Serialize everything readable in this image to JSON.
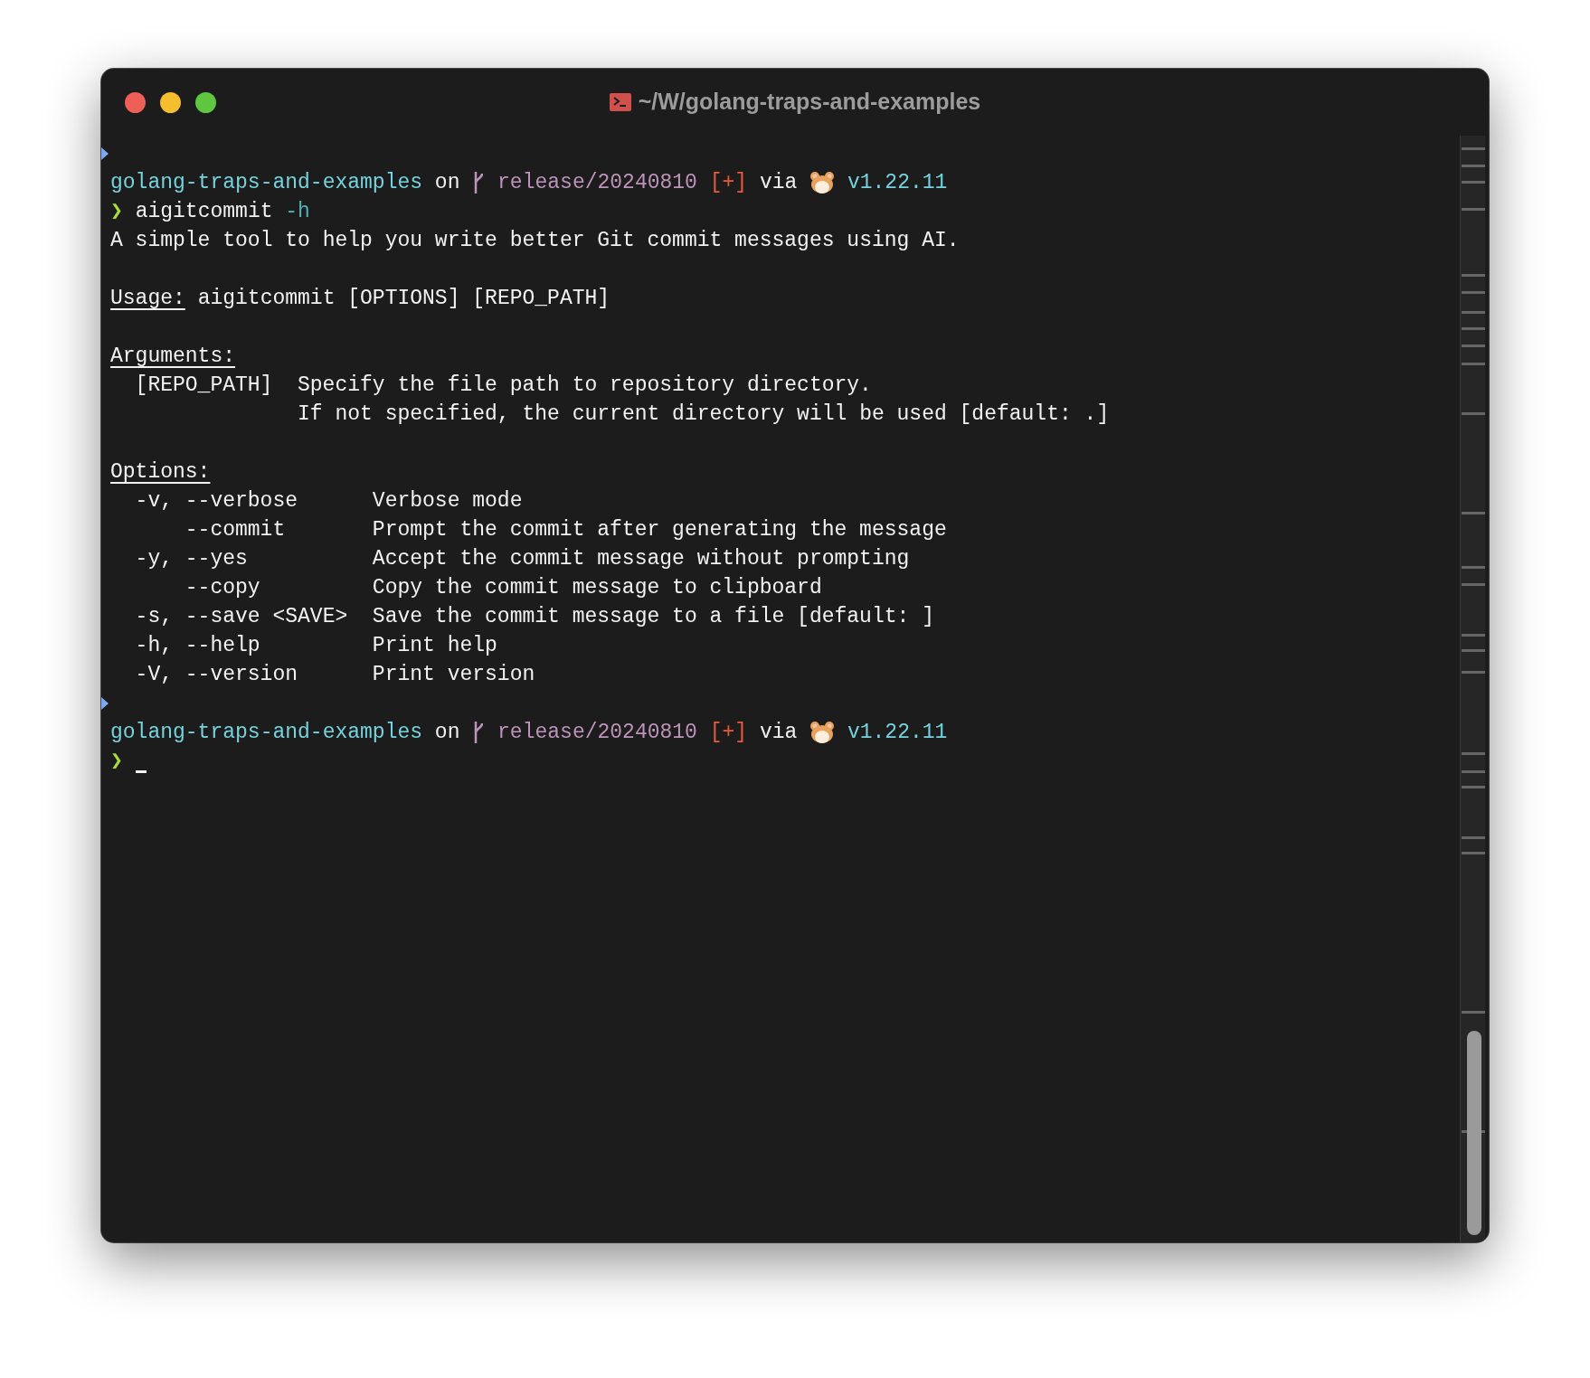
{
  "window": {
    "title": "~/W/golang-traps-and-examples"
  },
  "lines": [
    {
      "kind": "marker"
    },
    {
      "kind": "prompt",
      "dir": "golang-traps-and-examples",
      "on": "on",
      "branch": "release/20240810",
      "status": "[+]",
      "via": "via",
      "version": "v1.22.11"
    },
    {
      "kind": "command",
      "symbol": "❯",
      "command": "aigitcommit",
      "flag": "-h"
    },
    {
      "kind": "text",
      "text": "A simple tool to help you write better Git commit messages using AI."
    },
    {
      "kind": "blank"
    },
    {
      "kind": "heading",
      "heading": "Usage:",
      "rest": "aigitcommit [OPTIONS] [REPO_PATH]"
    },
    {
      "kind": "blank"
    },
    {
      "kind": "heading",
      "heading": "Arguments:"
    },
    {
      "kind": "argument",
      "name": "[REPO_PATH]",
      "desc": "Specify the file path to repository directory."
    },
    {
      "kind": "continuation",
      "desc": "If not specified, the current directory will be used [default: .]"
    },
    {
      "kind": "blank"
    },
    {
      "kind": "heading",
      "heading": "Options:"
    },
    {
      "kind": "option",
      "flags": "-v, --verbose",
      "desc": "Verbose mode"
    },
    {
      "kind": "option",
      "flags": "    --commit",
      "desc": "Prompt the commit after generating the message"
    },
    {
      "kind": "option",
      "flags": "-y, --yes",
      "desc": "Accept the commit message without prompting"
    },
    {
      "kind": "option",
      "flags": "    --copy",
      "desc": "Copy the commit message to clipboard"
    },
    {
      "kind": "option",
      "flags": "-s, --save <SAVE>",
      "desc": "Save the commit message to a file [default: ]"
    },
    {
      "kind": "option",
      "flags": "-h, --help",
      "desc": "Print help"
    },
    {
      "kind": "option",
      "flags": "-V, --version",
      "desc": "Print version"
    },
    {
      "kind": "marker"
    },
    {
      "kind": "prompt",
      "dir": "golang-traps-and-examples",
      "on": "on",
      "branch": "release/20240810",
      "status": "[+]",
      "via": "via",
      "version": "v1.22.11"
    },
    {
      "kind": "input",
      "symbol": "❯"
    }
  ]
}
